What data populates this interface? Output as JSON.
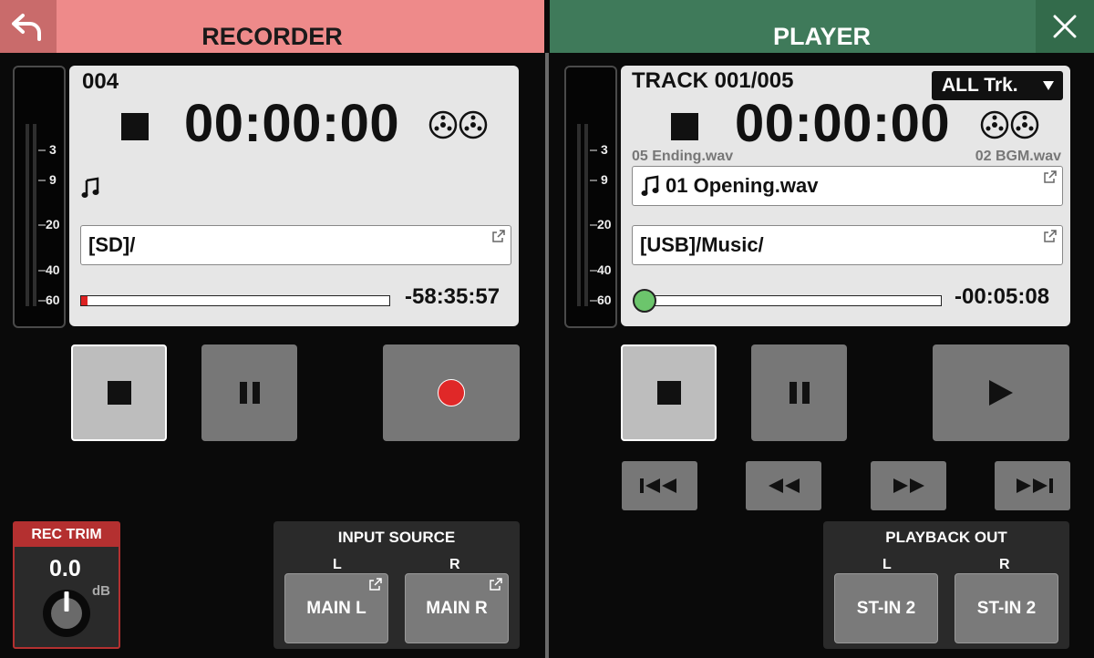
{
  "recorder": {
    "title": "RECORDER",
    "take_number": "004",
    "time": "00:00:00",
    "folder": "[SD]/",
    "progress": 0.02,
    "remaining": "-58:35:57",
    "meter_scale": [
      "3",
      "9",
      "20",
      "40",
      "60"
    ],
    "transport": [
      "stop",
      "pause",
      "record"
    ],
    "rec_trim": {
      "label": "REC TRIM",
      "value": "0.0",
      "unit": "dB"
    },
    "input_source": {
      "title": "INPUT SOURCE",
      "l_label": "L",
      "r_label": "R",
      "l_value": "MAIN L",
      "r_value": "MAIN R"
    }
  },
  "player": {
    "title": "PLAYER",
    "track_label": "TRACK 001/005",
    "play_mode": "ALL Trk.",
    "time": "00:00:00",
    "prev_file": "05 Ending.wav",
    "next_file": "02 BGM.wav",
    "current_file": "01 Opening.wav",
    "folder": "[USB]/Music/",
    "progress": 0.0,
    "remaining": "-00:05:08",
    "meter_scale": [
      "3",
      "9",
      "20",
      "40",
      "60"
    ],
    "transport": [
      "stop",
      "pause",
      "play"
    ],
    "skip_buttons": [
      "previous",
      "rewind",
      "fast-forward",
      "next"
    ],
    "playback_out": {
      "title": "PLAYBACK OUT",
      "l_label": "L",
      "r_label": "R",
      "l_value": "ST-IN 2",
      "r_value": "ST-IN 2"
    }
  },
  "icons": {
    "back": "back-arrow-icon",
    "close": "close-icon",
    "tape": "reel-icon",
    "note": "music-note-icon",
    "external": "external-link-icon"
  },
  "colors": {
    "recorder_header": "#ee8a8a",
    "player_header": "#3f7a5a",
    "record_dot": "#e02828",
    "play_knob": "#6cc56c",
    "rec_trim_border": "#b43030"
  }
}
